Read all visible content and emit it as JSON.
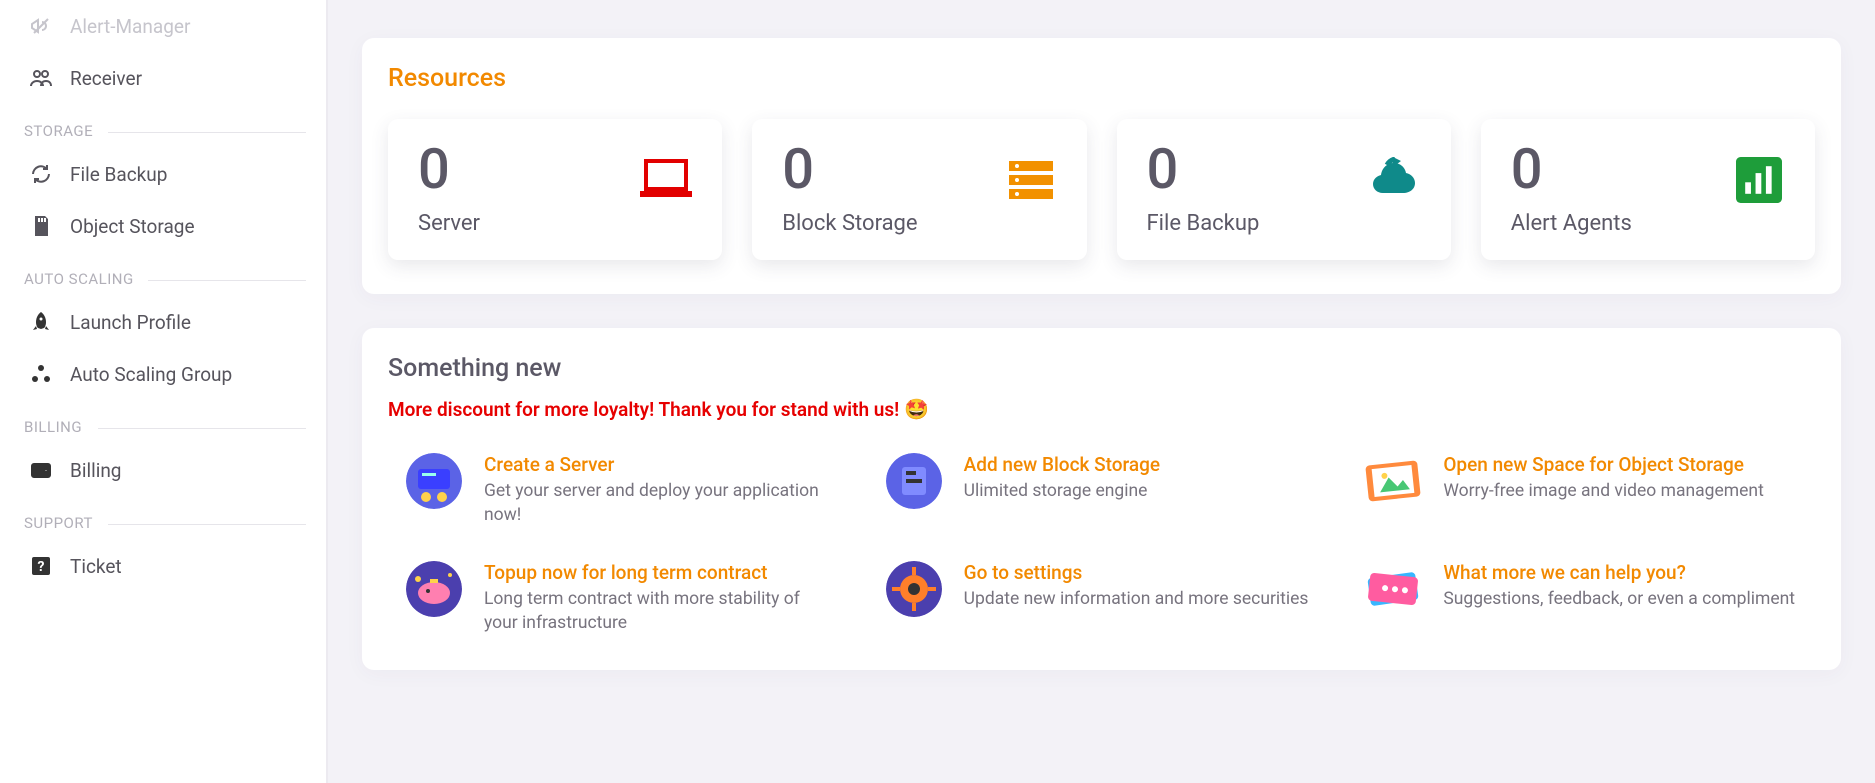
{
  "sidebar": {
    "items": [
      {
        "label": "Alert-Manager",
        "disabled": true
      },
      {
        "label": "Receiver"
      }
    ],
    "sections": [
      {
        "header": "STORAGE",
        "items": [
          {
            "label": "File Backup"
          },
          {
            "label": "Object Storage"
          }
        ]
      },
      {
        "header": "AUTO SCALING",
        "items": [
          {
            "label": "Launch Profile"
          },
          {
            "label": "Auto Scaling Group"
          }
        ]
      },
      {
        "header": "BILLING",
        "items": [
          {
            "label": "Billing"
          }
        ]
      },
      {
        "header": "SUPPORT",
        "items": [
          {
            "label": "Ticket"
          }
        ]
      }
    ]
  },
  "resources": {
    "title": "Resources",
    "cards": [
      {
        "value": "0",
        "label": "Server"
      },
      {
        "value": "0",
        "label": "Block Storage"
      },
      {
        "value": "0",
        "label": "File Backup"
      },
      {
        "value": "0",
        "label": "Alert Agents"
      }
    ]
  },
  "news": {
    "title": "Something new",
    "notice": "More discount for more loyalty! Thank you for stand with us! ",
    "notice_emoji": "🤩",
    "links": [
      {
        "title": "Create a Server",
        "desc": "Get your server and deploy your application now!"
      },
      {
        "title": "Add new Block Storage",
        "desc": "Ulimited storage engine"
      },
      {
        "title": "Open new Space for Object Storage",
        "desc": "Worry-free image and video management"
      },
      {
        "title": "Topup now for long term contract",
        "desc": "Long term contract with more stability of your infrastructure"
      },
      {
        "title": "Go to settings",
        "desc": "Update new information and more securities"
      },
      {
        "title": "What more we can help you?",
        "desc": "Suggestions, feedback, or even a compliment"
      }
    ]
  }
}
